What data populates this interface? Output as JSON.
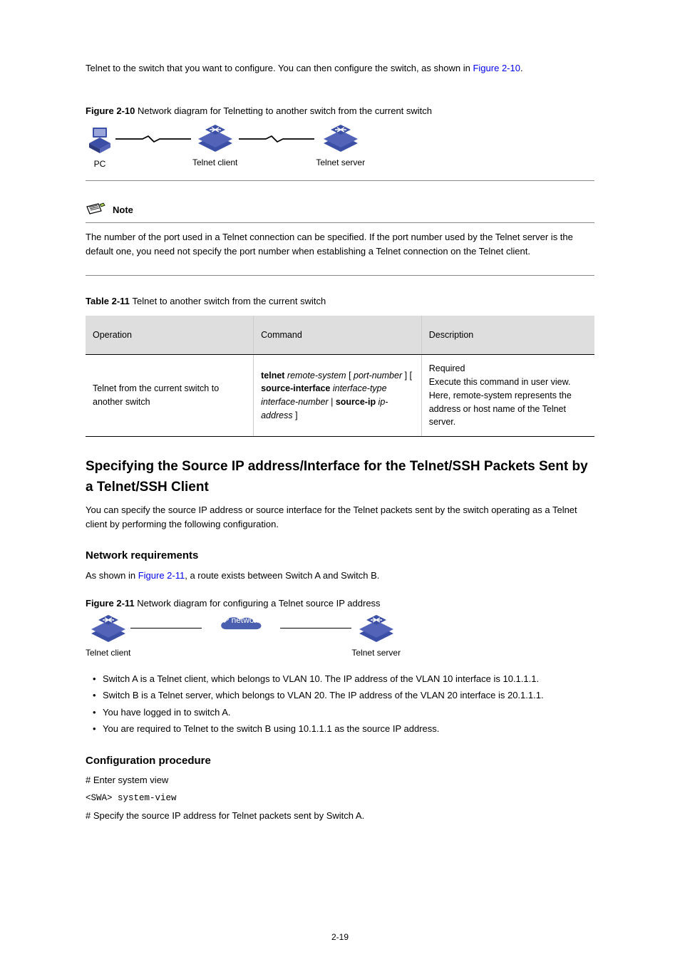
{
  "intro_text_prefix": "Telnet to the switch that you want to configure. You can then configure the switch, as shown in ",
  "intro_link_part1": "Figure",
  "intro_link_part2": "2-10",
  "intro_text_suffix": ".",
  "fig10_caption_prefix": "Figure 2-10 ",
  "fig10_caption": "Network diagram for Telnetting to another switch from the current switch",
  "fig10_labels": {
    "pc": "PC",
    "client": "Telnet client",
    "server": "Telnet server"
  },
  "note_label": "Note",
  "note_text": "The number of the port used in a Telnet connection can be specified. If the port number used by the Telnet server is the default one, you need not specify the port number when establishing a Telnet connection on the Telnet client.",
  "table_label": "Table 2-11 ",
  "table_title": "Telnet to another switch from the current switch",
  "table_headers": {
    "op": "Operation",
    "cmd": "Command",
    "desc": "Description"
  },
  "table_row": {
    "op": "Telnet from the current switch to another switch",
    "cmd_kw1": "telnet",
    "cmd_arg1": " remote-system",
    "cmd_seg1": " [ ",
    "cmd_arg2": "port-number",
    "cmd_seg2": " ] [ ",
    "cmd_kw2": "source-interface",
    "cmd_arg3": " interface-type interface-number",
    "cmd_seg3": " | ",
    "cmd_kw3": "source-ip",
    "cmd_arg4": " ip-address",
    "cmd_seg4": " ]",
    "desc": "Required\nExecute this command in user view. Here, remote-system represents the address or host name of the Telnet server."
  },
  "sec_title": "Specifying the Source IP address/Interface for the Telnet/SSH Packets Sent by a Telnet/SSH Client",
  "sec_para": "You can specify the source IP address or source interface for the Telnet packets sent by the switch operating as a Telnet client by performing the following configuration.",
  "sub_title": "Network requirements",
  "req_prefix": "As shown in ",
  "req_link": "Figure 2-11",
  "req_suffix": ", a route exists between Switch A and Switch B.",
  "fig11_caption_prefix": "Figure 2-11 ",
  "fig11_caption": "Network diagram for configuring a Telnet source IP address",
  "fig11_labels": {
    "client": "Telnet client",
    "cloud": "IP network",
    "server": "Telnet server"
  },
  "bullets": {
    "b1": "Switch A is a Telnet client, which belongs to VLAN 10. The IP address of the VLAN 10 interface is 10.1.1.1.",
    "b2": "Switch B is a Telnet server, which belongs to VLAN 20. The IP address of the VLAN 20 interface is 20.1.1.1.",
    "b3": "You have logged in to switch A.",
    "b4": "You are required to Telnet to the switch B using 10.1.1.1 as the source IP address."
  },
  "proc_title": "Configuration procedure",
  "proc_cmt1": "# Enter system view",
  "proc_cmd1": "<SWA> system-view",
  "proc_cmt2": "# Specify the source IP address for Telnet packets sent by Switch A.",
  "page_number": "2-19"
}
